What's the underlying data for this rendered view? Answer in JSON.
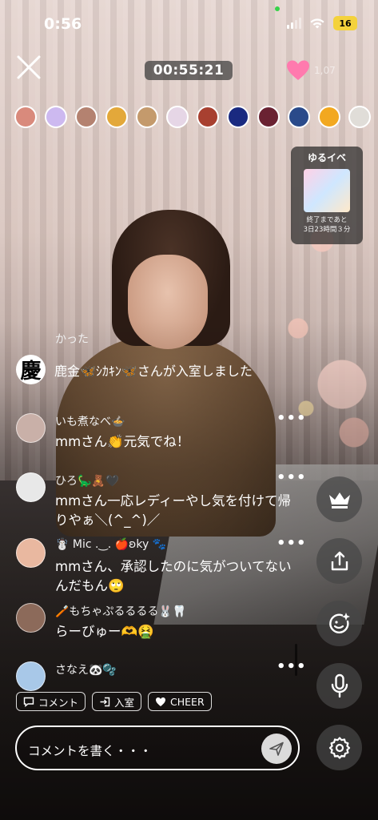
{
  "status_bar": {
    "time": "0:56",
    "battery": "16"
  },
  "top": {
    "timer": "00:55:21",
    "heart_count": "1,07"
  },
  "viewers": [
    {
      "icon": "viewer-avatar",
      "color": "#d98a7c"
    },
    {
      "icon": "viewer-avatar",
      "color": "#cdb9f0"
    },
    {
      "icon": "viewer-avatar",
      "color": "#b48270"
    },
    {
      "icon": "viewer-avatar",
      "color": "#e3a83a"
    },
    {
      "icon": "viewer-avatar",
      "color": "#c49a6c"
    },
    {
      "icon": "viewer-avatar",
      "color": "#e6d6e6"
    },
    {
      "icon": "viewer-avatar",
      "color": "#a84030"
    },
    {
      "icon": "viewer-avatar",
      "color": "#1a2a80"
    },
    {
      "icon": "viewer-avatar",
      "color": "#6a2232"
    },
    {
      "icon": "viewer-avatar",
      "color": "#2a4a8a"
    },
    {
      "icon": "viewer-avatar",
      "color": "#f2a820"
    },
    {
      "icon": "viewer-avatar",
      "color": "#e0ddd8"
    }
  ],
  "event": {
    "title": "ゆるイベ",
    "remaining_label": "終了まであと",
    "remaining_time": "3日23時間３分"
  },
  "chat": {
    "system_partial": "かった",
    "entry": {
      "avatar_char": "慶",
      "text": "鹿金🦋ｼｶｷﾝ🦋さんが入室しました"
    },
    "messages": [
      {
        "name": "いも煮なべ🍲",
        "text": "mmさん👏元気でね！",
        "avatar_color": "#c9b0a8"
      },
      {
        "name": "ひろ🦕🧸🖤",
        "text": "mmさん一応レディーやし気を付けて帰りやぁ＼(^_^)／",
        "avatar_color": "#e8e8e8"
      },
      {
        "name": "☃️ Mic .‿. 🍎ʚky 🐾",
        "text": "mmさん、承認したのに気がついてないんだもん🙄",
        "avatar_color": "#e9b8a0"
      },
      {
        "name": "🪥もちゃぷるるるる🐰🦷",
        "text": "らーびゅー🫶🤮",
        "avatar_color": "#8c6a5a"
      },
      {
        "name": "さなえ🐼🫧",
        "text": "",
        "avatar_color": "#a8c8e8"
      }
    ]
  },
  "chips": [
    {
      "icon": "comment-icon",
      "label": "コメント"
    },
    {
      "icon": "enter-icon",
      "label": "入室"
    },
    {
      "icon": "heart-icon",
      "label": "CHEER"
    }
  ],
  "comment_input": {
    "placeholder": "コメントを書く・・・"
  },
  "actions": [
    {
      "icon": "crown-icon"
    },
    {
      "icon": "share-icon"
    },
    {
      "icon": "effect-icon"
    },
    {
      "icon": "microphone-icon"
    },
    {
      "icon": "settings-icon"
    }
  ],
  "colors": {
    "heart": "#ff6fa6",
    "accent_white": "#ffffff"
  }
}
